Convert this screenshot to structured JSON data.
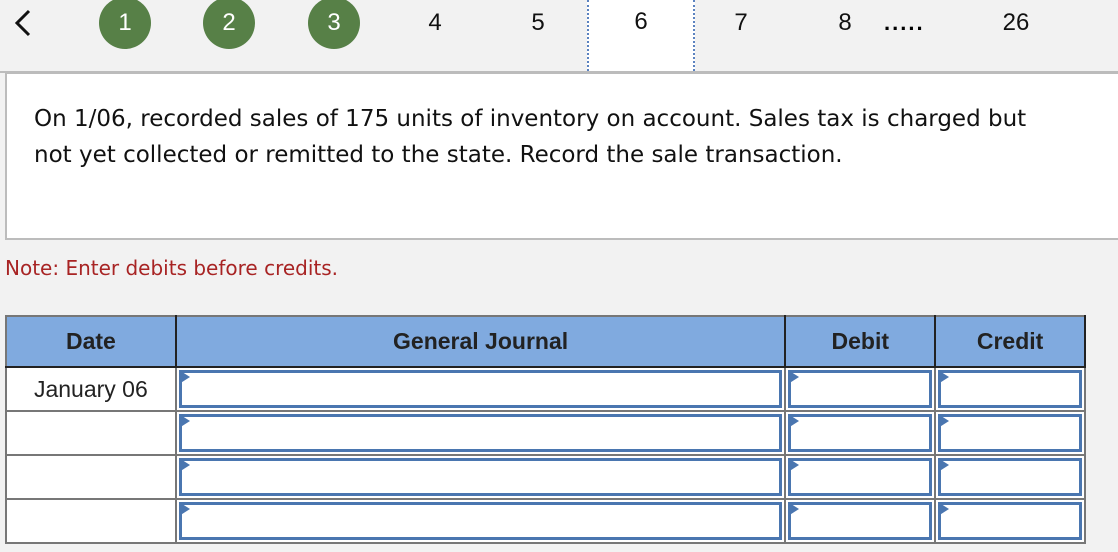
{
  "nav": {
    "back_icon": "chevron-left-icon",
    "steps": [
      {
        "label": "1",
        "state": "done"
      },
      {
        "label": "2",
        "state": "done"
      },
      {
        "label": "3",
        "state": "done"
      },
      {
        "label": "4",
        "state": "pending"
      },
      {
        "label": "5",
        "state": "pending"
      },
      {
        "label": "6",
        "state": "current"
      },
      {
        "label": "7",
        "state": "pending"
      },
      {
        "label": "8",
        "state": "pending"
      },
      {
        "label": "26",
        "state": "pending"
      }
    ],
    "ellipsis": ".....",
    "done_color": "#578047"
  },
  "question": {
    "text": "On 1/06, recorded sales of 175 units of inventory on account. Sales tax is charged but not yet collected or remitted to the state. Record the sale transaction."
  },
  "note": {
    "text": "Note: Enter debits before credits.",
    "color": "#a82424"
  },
  "journal": {
    "headers": [
      "Date",
      "General Journal",
      "Debit",
      "Credit"
    ],
    "header_color": "#80aadf",
    "rows": [
      {
        "date": "January 06",
        "account": "",
        "debit": "",
        "credit": ""
      },
      {
        "date": "",
        "account": "",
        "debit": "",
        "credit": ""
      },
      {
        "date": "",
        "account": "",
        "debit": "",
        "credit": ""
      },
      {
        "date": "",
        "account": "",
        "debit": "",
        "credit": ""
      }
    ]
  }
}
